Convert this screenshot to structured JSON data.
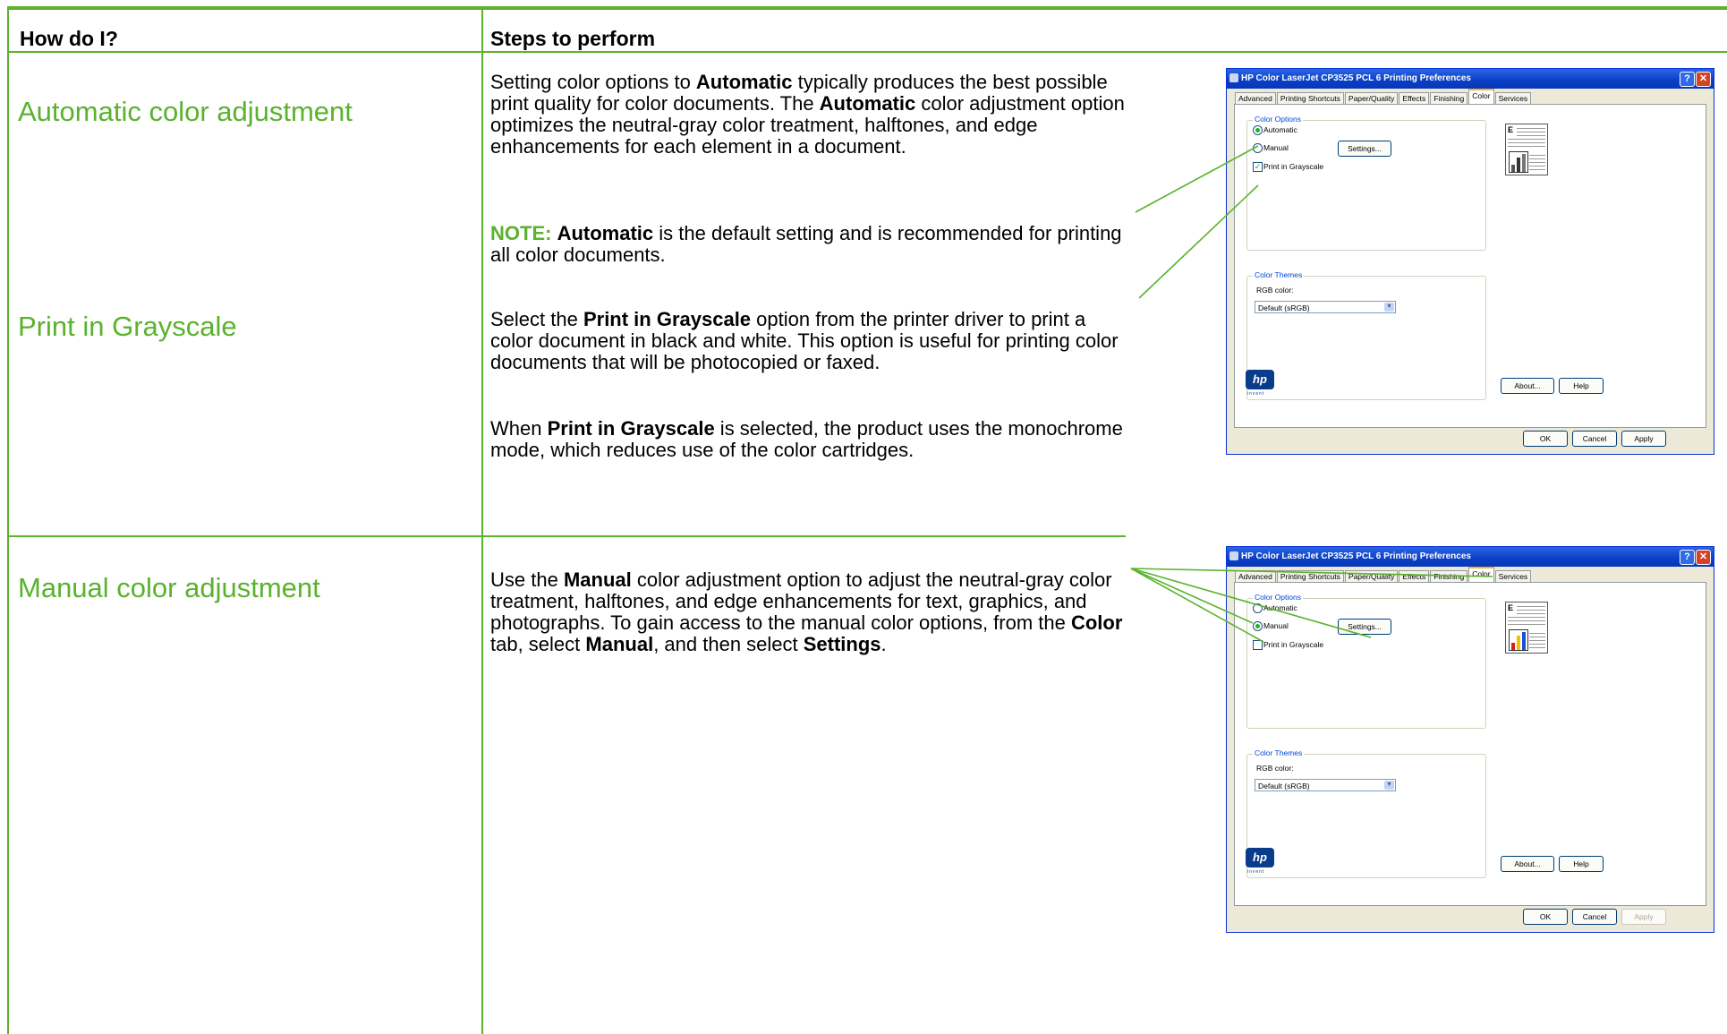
{
  "table": {
    "col1_header": "How do I?",
    "col2_header": "Steps to perform"
  },
  "rows": [
    {
      "task": "Automatic color adjustment",
      "p1": [
        {
          "t": "Setting color options to "
        },
        {
          "t": "Automatic",
          "b": true
        },
        {
          "t": " typically produces the best possible print quality for color documents. The "
        },
        {
          "t": "Automatic",
          "b": true
        },
        {
          "t": " color adjustment option optimizes the neutral-gray color treatment, halftones, and edge enhancements for each element in a document."
        }
      ],
      "note_label": "NOTE:",
      "note": [
        {
          "t": "Automatic",
          "b": true
        },
        {
          "t": " is the default setting and is recommended for printing all color documents."
        }
      ]
    },
    {
      "task": "Print in Grayscale",
      "p1": [
        {
          "t": "Select the "
        },
        {
          "t": "Print in Grayscale",
          "b": true
        },
        {
          "t": " option from the printer driver to print a color document in black and white. This option is useful for printing color documents that will be photocopied or faxed."
        }
      ],
      "p2": [
        {
          "t": "When "
        },
        {
          "t": "Print in Grayscale",
          "b": true
        },
        {
          "t": " is selected, the product uses the monochrome mode, which reduces use of the color cartridges."
        }
      ]
    },
    {
      "task": "Manual color adjustment",
      "p1": [
        {
          "t": "Use the "
        },
        {
          "t": "Manual",
          "b": true
        },
        {
          "t": " color adjustment option to adjust the neutral-gray color treatment, halftones, and edge enhancements for text, graphics, and photographs. To gain access to the manual color options, from the "
        },
        {
          "t": "Color",
          "b": true
        },
        {
          "t": " tab, select "
        },
        {
          "t": "Manual",
          "b": true
        },
        {
          "t": ", and then select "
        },
        {
          "t": "Settings",
          "b": true
        },
        {
          "t": "."
        }
      ]
    }
  ],
  "dialog": {
    "title": "HP Color LaserJet CP3525 PCL 6 Printing Preferences",
    "help_glyph": "?",
    "close_glyph": "✕",
    "tabs": [
      "Advanced",
      "Printing Shortcuts",
      "Paper/Quality",
      "Effects",
      "Finishing",
      "Color",
      "Services"
    ],
    "active_tab": "Color",
    "color_options_label": "Color Options",
    "automatic_label": "Automatic",
    "manual_label": "Manual",
    "settings_button": "Settings...",
    "grayscale_label": "Print in Grayscale",
    "color_themes_label": "Color Themes",
    "rgb_label": "RGB color:",
    "rgb_value": "Default (sRGB)",
    "preview_letter": "E",
    "about_button": "About...",
    "help_button": "Help",
    "ok_button": "OK",
    "cancel_button": "Cancel",
    "apply_button": "Apply",
    "logo_text": "hp",
    "logo_sub": "invent"
  },
  "dialog_states": [
    {
      "automatic": true,
      "manual": false,
      "grayscale": true,
      "apply_enabled": true
    },
    {
      "automatic": false,
      "manual": true,
      "grayscale": false,
      "apply_enabled": false
    }
  ],
  "colors": {
    "accent": "#5ab22d",
    "title_blue": "#0a3fc5"
  }
}
